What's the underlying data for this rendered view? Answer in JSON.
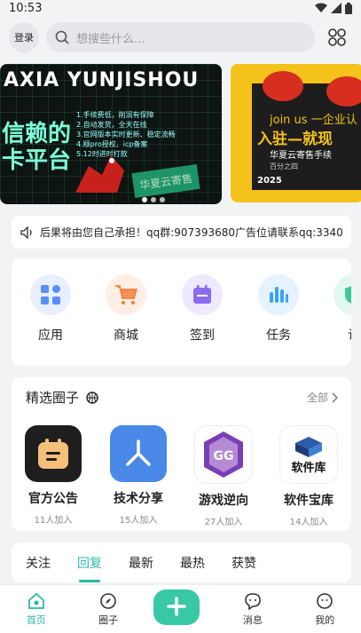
{
  "status": {
    "time": "10:53"
  },
  "header": {
    "login_label": "登录",
    "search_placeholder": "想搜些什么..."
  },
  "banners": [
    {
      "title": "AXIA YUNJISHOU",
      "headline_line1": "信赖的",
      "headline_line2": "卡平台",
      "stamp": "华夏云寄售",
      "list": [
        "1.手续费低，削润有保障",
        "2.自动发货，全天在线",
        "3.官网版本实时更新、稳定流畅",
        "4.顺pro授权、icp备案",
        "5.12时进时打款"
      ]
    },
    {
      "line1": "join us 一企业认",
      "line2": "入驻—就现",
      "line3": "华夏云寄售手续",
      "line4": "百分之四",
      "year": "2025"
    }
  ],
  "notice": {
    "text": "后果将由您自己承担！qq群:907393680广告位请联系qq:3340"
  },
  "quick_menu": [
    {
      "label": "应用",
      "icon": "apps-icon",
      "color": "#5b8ff9",
      "bg": "#e8f0ff"
    },
    {
      "label": "商城",
      "icon": "cart-icon",
      "color": "#f07b38",
      "bg": "#ffeee4"
    },
    {
      "label": "签到",
      "icon": "calendar-icon",
      "color": "#8b6cf0",
      "bg": "#efe9ff"
    },
    {
      "label": "任务",
      "icon": "tasks-icon",
      "color": "#3aa3f5",
      "bg": "#e4f3ff"
    },
    {
      "label": "认",
      "icon": "verify-icon",
      "color": "#3cc89a",
      "bg": "#e2f8ef"
    }
  ],
  "circles": {
    "title": "精选圈子",
    "all_label": "全部",
    "items": [
      {
        "name": "官方公告",
        "count": "11人加入"
      },
      {
        "name": "技术分享",
        "count": "15人加入"
      },
      {
        "name": "游戏逆向",
        "count": "27人加入"
      },
      {
        "name": "软件宝库",
        "count": "14人加入"
      }
    ],
    "gg_text": "GG",
    "rjk_text": "软件库"
  },
  "feed_tabs": [
    "关注",
    "回复",
    "最新",
    "最热",
    "获赞"
  ],
  "active_feed_tab": 1,
  "bottom_nav": [
    {
      "label": "首页",
      "icon": "home-icon"
    },
    {
      "label": "圈子",
      "icon": "compass-icon"
    },
    {
      "label": "",
      "icon": "plus-icon"
    },
    {
      "label": "消息",
      "icon": "message-icon"
    },
    {
      "label": "我的",
      "icon": "profile-icon"
    }
  ],
  "accent": "#2ab8a8"
}
